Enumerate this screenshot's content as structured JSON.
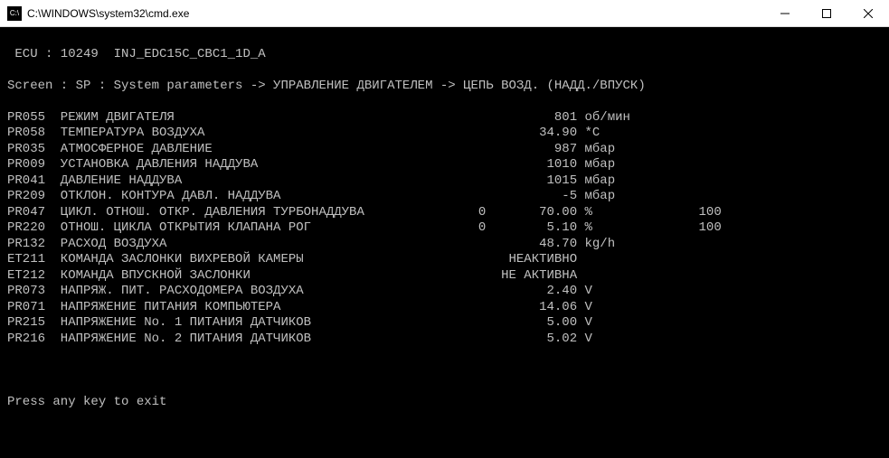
{
  "window": {
    "icon_label": "C:\\",
    "title": "C:\\WINDOWS\\system32\\cmd.exe"
  },
  "header": {
    "ecu_line": " ECU : 10249  INJ_EDC15C_CBC1_1D_A",
    "screen_line": "Screen : SP : System parameters -> УПРАВЛЕНИЕ ДВИГАТЕЛЕМ -> ЦЕПЬ ВОЗД. (НАДД./ВПУСК)"
  },
  "params": [
    {
      "code": "PR055",
      "name": "РЕЖИМ ДВИГАТЕЛЯ",
      "col3": "",
      "value": "801",
      "unit": "об/мин",
      "col6": ""
    },
    {
      "code": "PR058",
      "name": "ТЕМПЕРАТУРА ВОЗДУХА",
      "col3": "",
      "value": "34.90",
      "unit": "*C",
      "col6": ""
    },
    {
      "code": "PR035",
      "name": "АТМОСФЕРНОЕ ДАВЛЕНИЕ",
      "col3": "",
      "value": "987",
      "unit": "мбар",
      "col6": ""
    },
    {
      "code": "PR009",
      "name": "УСТАНОВКА ДАВЛЕНИЯ НАДДУВА",
      "col3": "",
      "value": "1010",
      "unit": "мбар",
      "col6": ""
    },
    {
      "code": "PR041",
      "name": "ДАВЛЕНИЕ НАДДУВА",
      "col3": "",
      "value": "1015",
      "unit": "мбар",
      "col6": ""
    },
    {
      "code": "PR209",
      "name": "ОТКЛОН. КОНТУРА ДАВЛ. НАДДУВА",
      "col3": "",
      "value": "-5",
      "unit": "мбар",
      "col6": ""
    },
    {
      "code": "PR047",
      "name": "ЦИКЛ. ОТНОШ. ОТКР. ДАВЛЕНИЯ ТУРБОНАДДУВА",
      "col3": "0",
      "value": "70.00",
      "unit": "%",
      "col6": "100"
    },
    {
      "code": "PR220",
      "name": "ОТНОШ. ЦИКЛА ОТКРЫТИЯ КЛАПАНА РОГ",
      "col3": "0",
      "value": "5.10",
      "unit": "%",
      "col6": "100"
    },
    {
      "code": "PR132",
      "name": "РАСХОД ВОЗДУХА",
      "col3": "",
      "value": "48.70",
      "unit": "kg/h",
      "col6": ""
    },
    {
      "code": "ET211",
      "name": "КОМАНДА ЗАСЛОНКИ ВИХРЕВОЙ КАМЕРЫ",
      "col3": "",
      "value": "НЕАКТИВНО",
      "unit": "",
      "col6": ""
    },
    {
      "code": "ET212",
      "name": "КОМАНДА ВПУСКНОЙ ЗАСЛОНКИ",
      "col3": "",
      "value": "НЕ АКТИВНА",
      "unit": "",
      "col6": ""
    },
    {
      "code": "PR073",
      "name": "НАПРЯЖ. ПИТ. РАСХОДОМЕРА ВОЗДУХА",
      "col3": "",
      "value": "2.40",
      "unit": "V",
      "col6": ""
    },
    {
      "code": "PR071",
      "name": "НАПРЯЖЕНИЕ ПИТАНИЯ КОМПЬЮТЕРА",
      "col3": "",
      "value": "14.06",
      "unit": "V",
      "col6": ""
    },
    {
      "code": "PR215",
      "name": "НАПРЯЖЕНИЕ No. 1 ПИТАНИЯ ДАТЧИКОВ",
      "col3": "",
      "value": "5.00",
      "unit": "V",
      "col6": ""
    },
    {
      "code": "PR216",
      "name": "НАПРЯЖЕНИЕ No. 2 ПИТАНИЯ ДАТЧИКОВ",
      "col3": "",
      "value": "5.02",
      "unit": "V",
      "col6": ""
    }
  ],
  "footer": {
    "prompt": "Press any key to exit"
  }
}
